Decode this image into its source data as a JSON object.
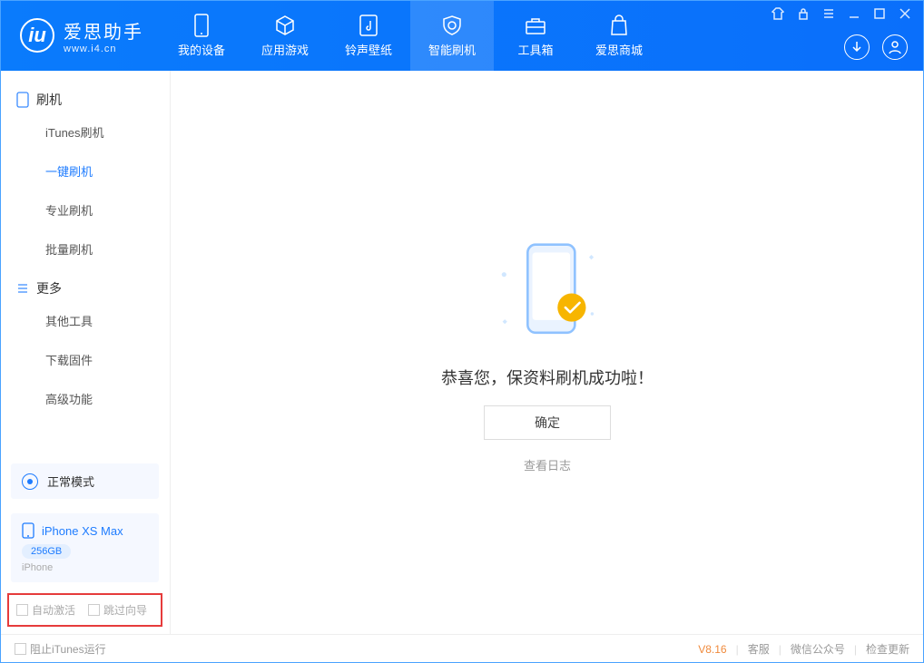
{
  "app": {
    "name_cn": "爱思助手",
    "url": "www.i4.cn",
    "logo_letter": "iu"
  },
  "tabs": [
    {
      "id": "device",
      "label": "我的设备"
    },
    {
      "id": "apps",
      "label": "应用游戏"
    },
    {
      "id": "media",
      "label": "铃声壁纸"
    },
    {
      "id": "flash",
      "label": "智能刷机",
      "active": true
    },
    {
      "id": "tools",
      "label": "工具箱"
    },
    {
      "id": "store",
      "label": "爱思商城"
    }
  ],
  "sidebar": {
    "groups": [
      {
        "title": "刷机",
        "items": [
          {
            "label": "iTunes刷机"
          },
          {
            "label": "一键刷机",
            "active": true
          },
          {
            "label": "专业刷机"
          },
          {
            "label": "批量刷机"
          }
        ]
      },
      {
        "title": "更多",
        "items": [
          {
            "label": "其他工具"
          },
          {
            "label": "下载固件"
          },
          {
            "label": "高级功能"
          }
        ]
      }
    ],
    "mode_label": "正常模式",
    "device": {
      "name": "iPhone XS Max",
      "capacity": "256GB",
      "type": "iPhone"
    },
    "checks": {
      "auto_activate": "自动激活",
      "skip_guide": "跳过向导"
    }
  },
  "main": {
    "success_message": "恭喜您，保资料刷机成功啦！",
    "ok_label": "确定",
    "view_log": "查看日志"
  },
  "statusbar": {
    "block_itunes": "阻止iTunes运行",
    "version": "V8.16",
    "links": [
      "客服",
      "微信公众号",
      "检查更新"
    ]
  }
}
